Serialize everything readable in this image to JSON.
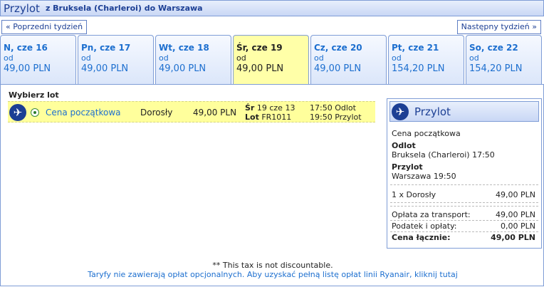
{
  "header": {
    "title": "Przylot",
    "route": "z Bruksela (Charleroi) do Warszawa"
  },
  "nav": {
    "prev": "« Poprzedni tydzień",
    "next": "Następny tydzień »"
  },
  "tabs": [
    {
      "day": "N, cze 16",
      "od": "od",
      "price": "49,00 PLN"
    },
    {
      "day": "Pn, cze 17",
      "od": "od",
      "price": "49,00 PLN"
    },
    {
      "day": "Wt, cze 18",
      "od": "od",
      "price": "49,00 PLN"
    },
    {
      "day": "Śr, cze 19",
      "od": "od",
      "price": "49,00 PLN"
    },
    {
      "day": "Cz, cze 20",
      "od": "od",
      "price": "49,00 PLN"
    },
    {
      "day": "Pt, cze 21",
      "od": "od",
      "price": "154,20 PLN"
    },
    {
      "day": "So, cze 22",
      "od": "od",
      "price": "154,20 PLN"
    }
  ],
  "flight": {
    "heading": "Wybierz lot",
    "fare": "Cena początkowa",
    "passenger": "Dorosły",
    "price": "49,00 PLN",
    "day_label": "Śr",
    "date": "19 cze 13",
    "flight_label": "Lot",
    "flight_no": "FR1011",
    "depart": "17:50 Odlot",
    "arrive": "19:50 Przylot"
  },
  "summary": {
    "title": "Przylot",
    "fare": "Cena początkowa",
    "depart_label": "Odlot",
    "depart_value": "Bruksela (Charleroi) 17:50",
    "arrive_label": "Przylot",
    "arrive_value": "Warszawa 19:50",
    "pax_label": "1 x Dorosły",
    "pax_value": "49,00 PLN",
    "transport_label": "Opłata za transport:",
    "transport_value": "49,00 PLN",
    "tax_label": "Podatek i opłaty:",
    "tax_value": "0,00 PLN",
    "total_label": "Cena łącznie:",
    "total_value": "49,00 PLN"
  },
  "footer": {
    "note": "** This tax is not discountable.",
    "link": "Taryfy nie zawierają opłat opcjonalnych. Aby uzyskać pełną listę opłat linii Ryanair, kliknij tutaj"
  },
  "selected_tab_index": 3
}
